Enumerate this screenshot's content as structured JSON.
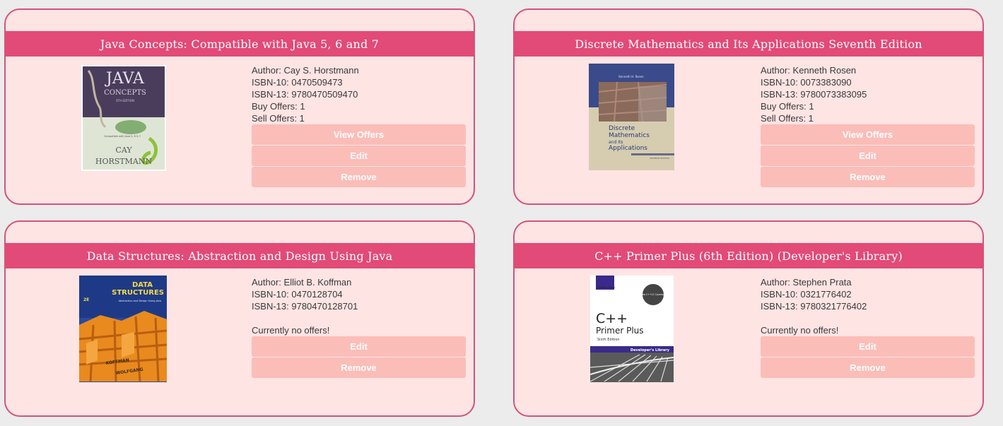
{
  "books": [
    {
      "title": "Java Concepts: Compatible with Java 5, 6 and 7",
      "author": "Author: Cay S. Horstmann",
      "isbn10": "ISBN-10: 0470509473",
      "isbn13": "ISBN-13: 9780470509470",
      "buy_offers": "Buy Offers: 1",
      "sell_offers": "Sell Offers: 1",
      "buttons": [
        "View Offers",
        "Edit",
        "Remove"
      ],
      "cover": {
        "title_line1": "JAVA",
        "title_line2": "CONCEPTS",
        "edition": "6TH EDITION",
        "subtitle": "Compatible with Java 5, 6 & 7",
        "author_line1": "CAY",
        "author_line2": "HORSTMANN"
      }
    },
    {
      "title": "Discrete Mathematics and Its Applications Seventh Edition",
      "author": "Author: Kenneth Rosen",
      "isbn10": "ISBN-10: 0073383090",
      "isbn13": "ISBN-13: 9780073383095",
      "buy_offers": "Buy Offers: 1",
      "sell_offers": "Sell Offers: 1",
      "buttons": [
        "View Offers",
        "Edit",
        "Remove"
      ],
      "cover": {
        "author": "Kenneth H. Rosen",
        "title_line1": "Discrete",
        "title_line2": "Mathematics",
        "title_line3": "and Its",
        "title_line4": "Applications",
        "edition": "SEVENTH EDITION"
      }
    },
    {
      "title": "Data Structures: Abstraction and Design Using Java",
      "author": "Author: Elliot B. Koffman",
      "isbn10": "ISBN-10: 0470128704",
      "isbn13": "ISBN-13: 9780470128701",
      "no_offers": "Currently no offers!",
      "buttons": [
        "Edit",
        "Remove"
      ],
      "cover": {
        "title_line1": "DATA",
        "title_line2": "STRUCTURES",
        "edition": "2E",
        "subtitle": "Abstraction and Design Using Java",
        "author_line1": "KOFFMAN",
        "author_line2": "WOLFGANG"
      }
    },
    {
      "title": "C++ Primer Plus (6th Edition) (Developer's Library)",
      "author": "Author: Stephen Prata",
      "isbn10": "ISBN-10: 0321776402",
      "isbn13": "ISBN-13: 9780321776402",
      "no_offers": "Currently no offers!",
      "buttons": [
        "Edit",
        "Remove"
      ],
      "cover": {
        "author": "Stephen Prata",
        "badge": "New C++11 Coverage",
        "title_line1": "C++",
        "title_line2": "Primer Plus",
        "edition": "Sixth Edition",
        "series": "Developer's Library"
      }
    }
  ],
  "colors": {
    "page_bg": "#ececec",
    "card_bg": "#ffe4e4",
    "card_border": "#d4537a",
    "title_bar": "#e24a78",
    "button_bg": "#fbbdb8",
    "text": "#3a3a3a"
  }
}
